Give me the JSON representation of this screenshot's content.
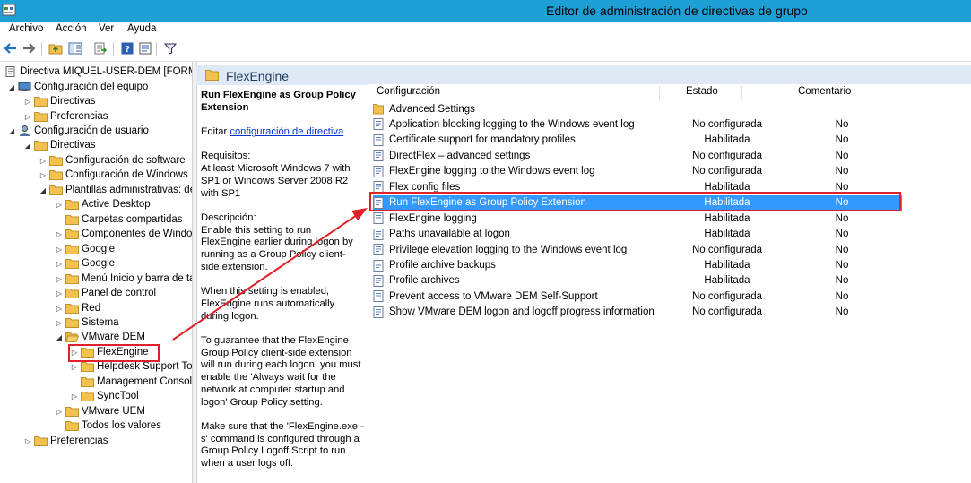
{
  "window": {
    "title": "Editor de administración de directivas de grupo"
  },
  "menu": [
    "Archivo",
    "Acción",
    "Ver",
    "Ayuda"
  ],
  "toolbar": {
    "icons": [
      "back-arrow-icon",
      "forward-arrow-icon",
      "up-folder-icon",
      "show-tree-icon",
      "export-list-icon",
      "help-icon",
      "properties-icon",
      "filter-icon"
    ]
  },
  "tree": {
    "root": "Directiva MIQUEL-USER-DEM [FORMAC",
    "computer_config": "Configuración del equipo",
    "directivas_1": "Directivas",
    "preferencias_1": "Preferencias",
    "user_config": "Configuración de usuario",
    "directivas_2": "Directivas",
    "software": "Configuración de software",
    "windows": "Configuración de Windows",
    "admin_templates": "Plantillas administrativas: de",
    "active_desktop": "Active Desktop",
    "shared_folders": "Carpetas compartidas",
    "windows_components": "Componentes de Windo",
    "google1": "Google",
    "google2": "Google",
    "start_menu": "Menú Inicio y barra de ta",
    "control_panel": "Panel de control",
    "network": "Red",
    "system": "Sistema",
    "vmware_dem": "VMware DEM",
    "flexengine": "FlexEngine",
    "helpdesk": "Helpdesk Support To",
    "mgmt_console": "Management Consol",
    "synctool": "SyncTool",
    "vmware_uem": "VMware UEM",
    "all_values": "Todos los valores",
    "preferencias_2": "Preferencias"
  },
  "header": {
    "title": "FlexEngine"
  },
  "description": {
    "policy_name": "Run FlexEngine as Group Policy Extension",
    "edit_prefix": "Editar ",
    "edit_link": "configuración de directiva",
    "requirements_label": "Requisitos:",
    "requirements_text": "At least Microsoft Windows 7 with SP1 or Windows Server 2008 R2 with SP1",
    "description_label": "Descripción:",
    "para1": "Enable this setting to run FlexEngine earlier during logon by running as a Group Policy client-side extension.",
    "para2": "When this setting is enabled, FlexEngine runs automatically during logon.",
    "para3": "To guarantee that the FlexEngine Group Policy client-side extension will run during each logon, you must enable the 'Always wait for the network at computer startup and logon' Group Policy setting.",
    "para4": "Make sure that the 'FlexEngine.exe -s' command is configured through a Group Policy Logoff Script to run when a user logs off."
  },
  "list": {
    "columns": {
      "setting": "Configuración",
      "state": "Estado",
      "comment": "Comentario"
    },
    "rows": [
      {
        "name": "Advanced Settings",
        "state": "",
        "comment": "",
        "folder": true
      },
      {
        "name": "Application blocking logging to the Windows event log",
        "state": "No configurada",
        "comment": "No"
      },
      {
        "name": "Certificate support for mandatory profiles",
        "state": "Habilitada",
        "comment": "No"
      },
      {
        "name": "DirectFlex – advanced settings",
        "state": "No configurada",
        "comment": "No"
      },
      {
        "name": "FlexEngine logging to the Windows event log",
        "state": "No configurada",
        "comment": "No"
      },
      {
        "name": "Flex config files",
        "state": "Habilitada",
        "comment": "No"
      },
      {
        "name": "Run FlexEngine as Group Policy Extension",
        "state": "Habilitada",
        "comment": "No",
        "selected": true
      },
      {
        "name": "FlexEngine logging",
        "state": "Habilitada",
        "comment": "No"
      },
      {
        "name": "Paths unavailable at logon",
        "state": "Habilitada",
        "comment": "No"
      },
      {
        "name": "Privilege elevation logging to the Windows event log",
        "state": "No configurada",
        "comment": "No"
      },
      {
        "name": "Profile archive backups",
        "state": "Habilitada",
        "comment": "No"
      },
      {
        "name": "Profile archives",
        "state": "Habilitada",
        "comment": "No"
      },
      {
        "name": "Prevent access to VMware DEM Self-Support",
        "state": "No configurada",
        "comment": "No"
      },
      {
        "name": "Show VMware DEM logon and logoff progress information",
        "state": "No configurada",
        "comment": "No"
      }
    ]
  },
  "colors": {
    "titlebar": "#1e9fd6",
    "selection": "#3399ff",
    "highlight": "#e0202a",
    "folder": "#f2c14e"
  }
}
